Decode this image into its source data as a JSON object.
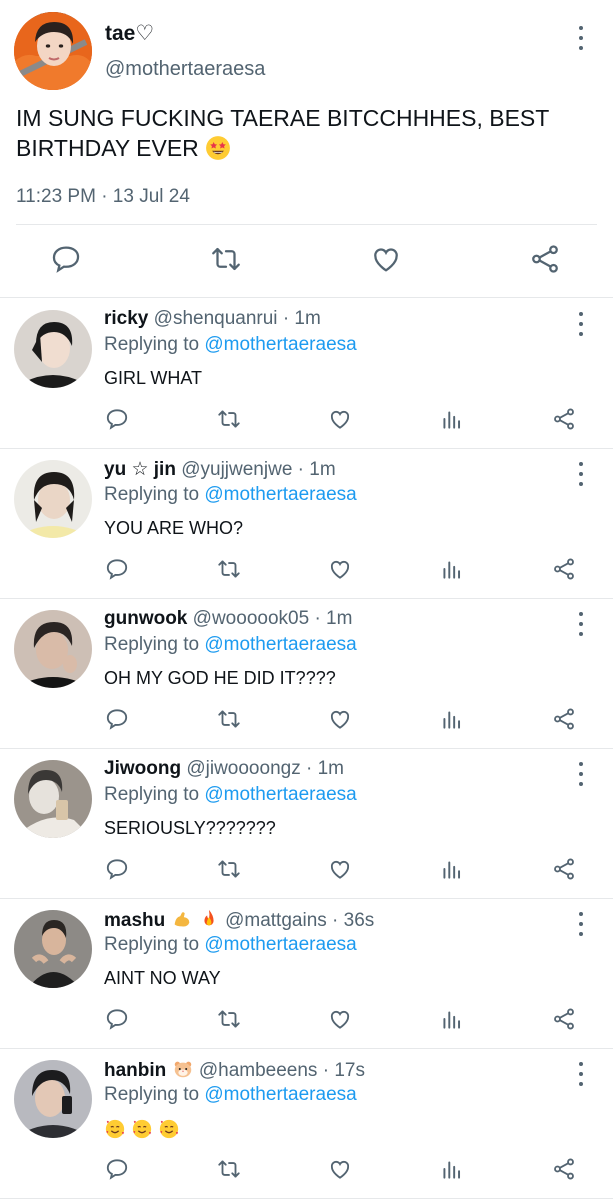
{
  "main_tweet": {
    "name": "tae♡",
    "handle": "@mothertaeraesa",
    "text": "IM SUNG FUCKING TAERAE BITCCHHHES, BEST BIRTHDAY EVER",
    "text_emoji": "star-struck-emoji",
    "time": "11:23 PM · 13 Jul 24",
    "actions": [
      "reply-icon",
      "retweet-icon",
      "like-icon",
      "share-icon"
    ]
  },
  "replies": [
    {
      "name": "ricky",
      "handle": "@shenquanrui",
      "age": "· 1m",
      "replying_prefix": "Replying to",
      "replying_to": "@mothertaeraesa",
      "text": "GIRL WHAT",
      "avatar_color": "#2a2a2a",
      "avatar_skin": "#f0ddd0"
    },
    {
      "name": "yu ☆ jin",
      "handle": "@yujjwenjwe",
      "age": "· 1m",
      "replying_prefix": "Replying to",
      "replying_to": "@mothertaeraesa",
      "text": "YOU ARE WHO?",
      "avatar_color": "#1f1c1a",
      "avatar_skin": "#ead6c6"
    },
    {
      "name": "gunwook",
      "handle": "@woooook05",
      "age": "· 1m",
      "replying_prefix": "Replying to",
      "replying_to": "@mothertaeraesa",
      "text": "OH MY GOD HE DID IT????",
      "avatar_color": "#2b2523",
      "avatar_skin": "#d9bba8"
    },
    {
      "name": "Jiwoong",
      "handle": "@jiwoooongz",
      "age": "· 1m",
      "replying_prefix": "Replying to",
      "replying_to": "@mothertaeraesa",
      "text": "SERIOUSLY???????",
      "avatar_color": "#3a3836",
      "avatar_skin": "#e6e2dc"
    },
    {
      "name": "mashu",
      "name_emojis": [
        "flexed-biceps-emoji",
        "fire-emoji"
      ],
      "handle": "@mattgains",
      "age": "· 36s",
      "replying_prefix": "Replying to",
      "replying_to": "@mothertaeraesa",
      "text": "AINT NO WAY",
      "avatar_color": "#3b3a38",
      "avatar_skin": "#d8b59c"
    },
    {
      "name": "hanbin",
      "name_emojis": [
        "hamster-emoji"
      ],
      "handle": "@hambeeens",
      "age": "· 17s",
      "replying_prefix": "Replying to",
      "replying_to": "@mothertaeraesa",
      "text": "",
      "text_emojis": [
        "smiling-face-with-hearts-emoji",
        "smiling-face-with-hearts-emoji",
        "smiling-face-with-hearts-emoji"
      ],
      "avatar_color": "#2d2e33",
      "avatar_skin": "#e3c8b6"
    }
  ],
  "reply_actions": [
    "reply-icon",
    "retweet-icon",
    "like-icon",
    "views-icon",
    "share-icon"
  ],
  "colors": {
    "accent": "#1d9bf0",
    "secondary_text": "#536471",
    "divider": "#e6e8ea"
  }
}
